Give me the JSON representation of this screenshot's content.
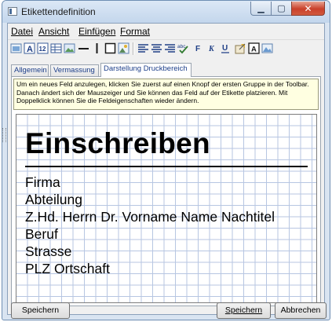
{
  "window": {
    "title": "Etikettendefinition"
  },
  "menu": [
    {
      "label": "Datei"
    },
    {
      "label": "Ansicht"
    },
    {
      "label": "Einfügen"
    },
    {
      "label": "Format"
    }
  ],
  "toolbar_icons": [
    "insert-image-icon",
    "text-field-icon",
    "numbered-field-icon",
    "table-field-icon",
    "image-field-icon",
    "horizontal-line-icon",
    "vertical-line-icon",
    "rectangle-icon",
    "picture-frame-icon",
    "align-left-icon",
    "align-center-icon",
    "align-right-icon",
    "spellcheck-icon",
    "bold-icon",
    "italic-icon",
    "underline-icon",
    "properties-icon",
    "text-frame-icon",
    "image-frame-icon"
  ],
  "toolbar_text_glyphs": {
    "font": "F",
    "italic": "K",
    "underline": "U"
  },
  "tabs": [
    {
      "label": "Allgemein",
      "active": false
    },
    {
      "label": "Vermassung",
      "active": false
    },
    {
      "label": "Darstellung Druckbereich",
      "active": true
    }
  ],
  "hint_text": "Um ein neues Feld anzulegen, klicken Sie zuerst auf einen Knopf der ersten Gruppe in der Toolbar. Danach ändert sich der Mauszeiger und Sie können das Feld auf der Etikette platzieren. Mit Doppelklick können Sie die Feldeigenschaften wieder ändern.",
  "label": {
    "title": "Einschreiben",
    "fields": [
      "Firma",
      "Abteilung",
      "Z.Hd. Herrn Dr. Vorname Name Nachtitel",
      "Beruf",
      "Strasse",
      "PLZ Ortschaft"
    ]
  },
  "buttons": {
    "save_as": "Speichern unter",
    "save": "Speichern",
    "cancel": "Abbrechen"
  },
  "colors": {
    "grid": "#b7c6e2",
    "hint_background": "#ffffe1",
    "tab_text": "#1d3f8a",
    "close_button": "#c9402a"
  }
}
